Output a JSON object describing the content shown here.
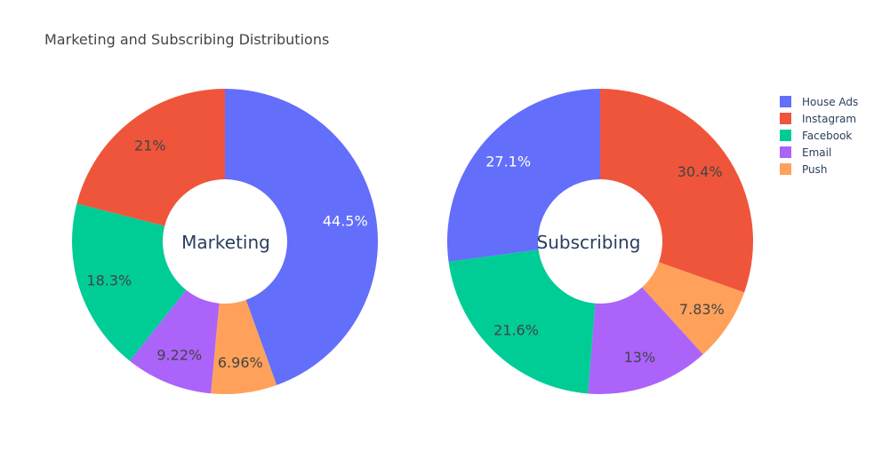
{
  "title": "Marketing and Subscribing Distributions",
  "colors": {
    "House Ads": "#636efa",
    "Instagram": "#ef553b",
    "Facebook": "#00cc96",
    "Email": "#ab63fa",
    "Push": "#ffa15a"
  },
  "legend": {
    "placement": "top-right",
    "items": [
      "House Ads",
      "Instagram",
      "Facebook",
      "Email",
      "Push"
    ]
  },
  "chart_data": [
    {
      "type": "pie",
      "hole": true,
      "center_label": "Marketing",
      "slices": [
        {
          "label": "House Ads",
          "value": 44.5,
          "text": "44.5%"
        },
        {
          "label": "Push",
          "value": 6.96,
          "text": "6.96%"
        },
        {
          "label": "Email",
          "value": 9.22,
          "text": "9.22%"
        },
        {
          "label": "Facebook",
          "value": 18.3,
          "text": "18.3%"
        },
        {
          "label": "Instagram",
          "value": 21,
          "text": "21%"
        }
      ]
    },
    {
      "type": "pie",
      "hole": true,
      "center_label": "Subscribing",
      "slices": [
        {
          "label": "Instagram",
          "value": 30.4,
          "text": "30.4%"
        },
        {
          "label": "Push",
          "value": 7.83,
          "text": "7.83%"
        },
        {
          "label": "Email",
          "value": 13,
          "text": "13%"
        },
        {
          "label": "Facebook",
          "value": 21.6,
          "text": "21.6%"
        },
        {
          "label": "House Ads",
          "value": 27.1,
          "text": "27.1%"
        }
      ]
    }
  ]
}
